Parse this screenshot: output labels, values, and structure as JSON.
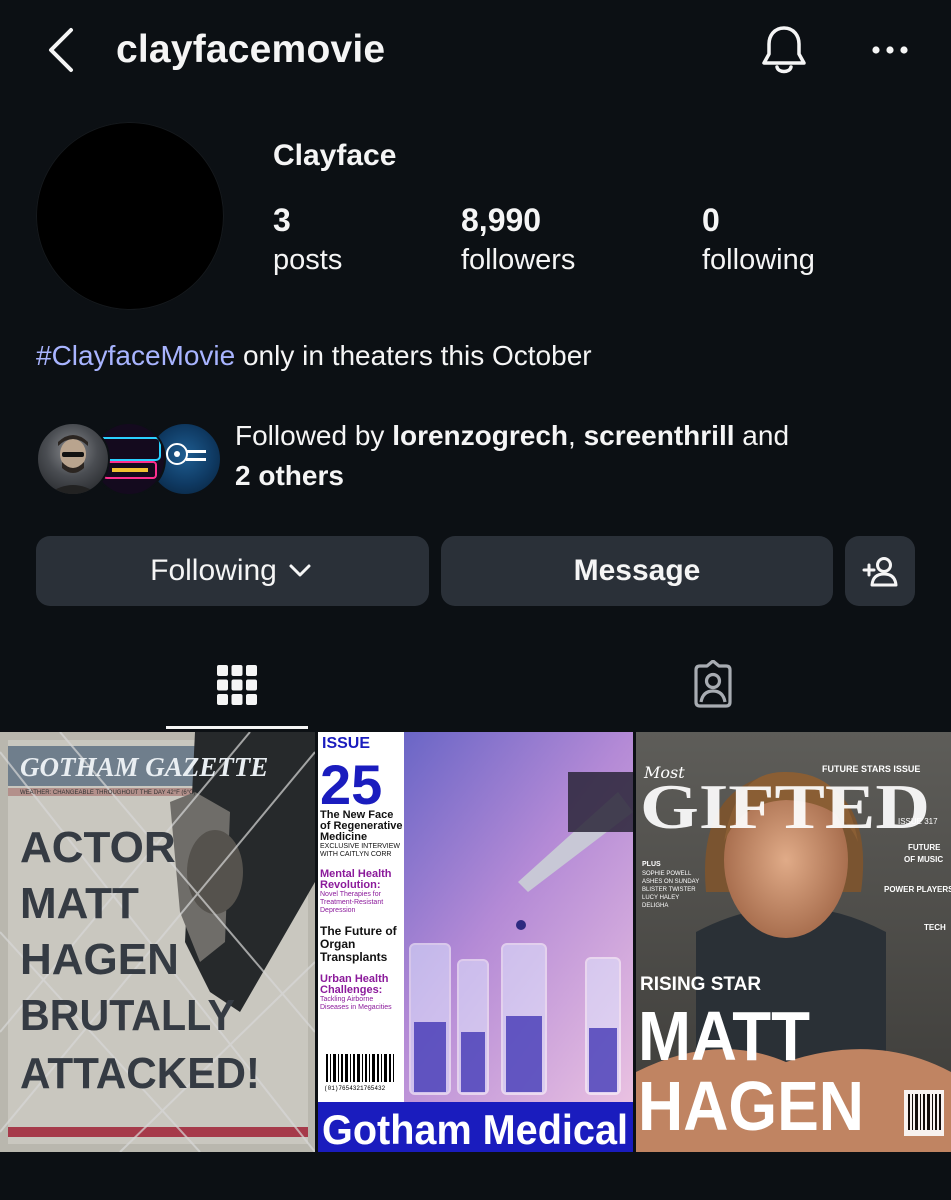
{
  "header": {
    "username": "clayfacemovie",
    "back_icon": "chevron-left-icon",
    "bell_icon": "bell-icon",
    "more_icon": "more-horizontal-icon"
  },
  "profile": {
    "display_name": "Clayface",
    "stats": [
      {
        "value": "3",
        "label": "posts"
      },
      {
        "value": "8,990",
        "label": "followers"
      },
      {
        "value": "0",
        "label": "following"
      }
    ],
    "bio": {
      "hashtag": "#ClayfaceMovie",
      "text": " only in theaters this October"
    }
  },
  "followed_by": {
    "prefix": "Followed by ",
    "user1": "lorenzogrech",
    "separator": ", ",
    "user2": "screenthrill",
    "conjunction": " and",
    "others": "2 others"
  },
  "actions": {
    "following_label": "Following",
    "message_label": "Message",
    "add_icon": "add-person-icon"
  },
  "tabs": {
    "grid_icon": "grid-icon",
    "tagged_icon": "tagged-person-icon"
  },
  "posts": [
    {
      "masthead": "GOTHAM GAZETTE",
      "weather": "WEATHER: CHANGEABLE THROUGHOUT THE DAY 42°F (6°C)",
      "headline": [
        "ACTOR",
        "MATT",
        "HAGEN",
        "BRUTALLY",
        "ATTACKED!"
      ]
    },
    {
      "issue_label": "ISSUE",
      "issue_number": "25",
      "items": [
        {
          "title": "The New Face of Regenerative Medicine",
          "sub": "EXCLUSIVE INTERVIEW WITH CAITLYN CORR"
        },
        {
          "title": "Mental Health Revolution:",
          "sub": "Novel Therapies for Treatment-Resistant Depression"
        },
        {
          "title": "The Future of Organ Transplants",
          "sub": ""
        },
        {
          "title": "Urban Health Challenges:",
          "sub": "Tackling Airborne Diseases in Megacities"
        }
      ],
      "barcode_number": "(01)7654321765432",
      "masthead": "Gotham Medical"
    },
    {
      "brand_small": "Most",
      "brand": "GIFTED",
      "special": "FUTURE STARS ISSUE",
      "issue": "ISSUE 317",
      "side_right": [
        "FUTURE",
        "OF MUSIC",
        "POWER PLAYERS",
        "TECH"
      ],
      "side_left": [
        "PLUS",
        "SOPHIE POWELL",
        "ASHES ON SUNDAY",
        "BLISTER TWISTER",
        "LUCY HALEY",
        "DELIGHA"
      ],
      "kicker": "RISING STAR",
      "name_line1": "MATT",
      "name_line2": "HAGEN"
    }
  ]
}
